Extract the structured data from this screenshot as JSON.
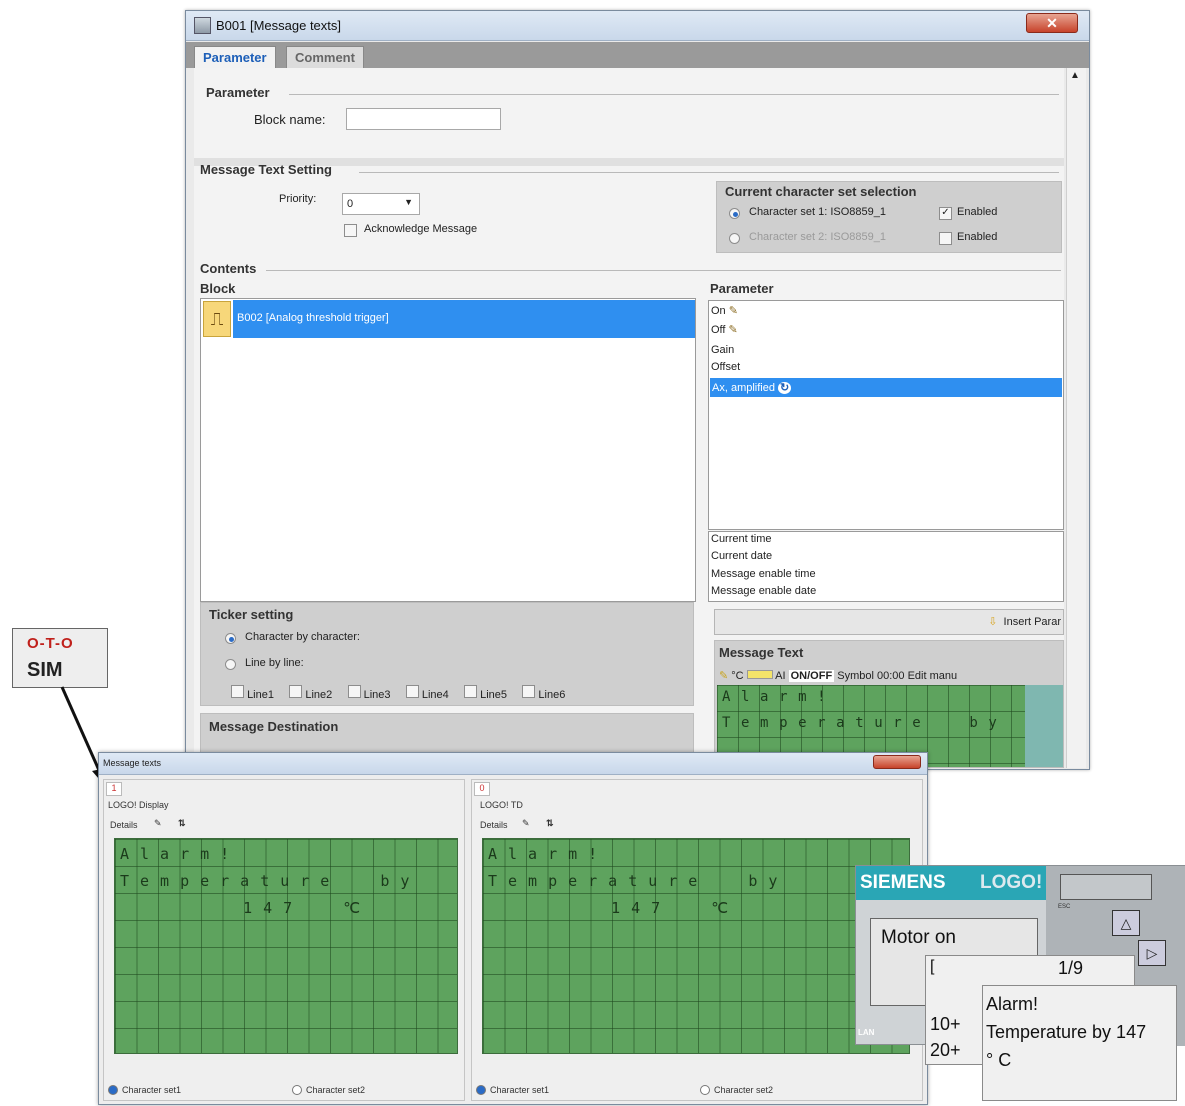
{
  "main_window": {
    "title": "B001 [Message texts]",
    "tabs": [
      "Parameter",
      "Comment"
    ],
    "parameter_section": {
      "title": "Parameter",
      "block_name_label": "Block name:",
      "block_name_value": ""
    },
    "message_text_setting": {
      "title": "Message Text Setting",
      "priority_label": "Priority:",
      "priority_value": "0",
      "acknowledge_label": "Acknowledge Message"
    },
    "charset_selection": {
      "title": "Current character set selection",
      "set1_label": "Character set 1: ISO8859_1",
      "set1_enabled": "Enabled",
      "set2_label": "Character set 2: ISO8859_1",
      "set2_enabled": "Enabled"
    },
    "contents": {
      "title": "Contents",
      "block_header": "Block",
      "block_item": "B002 [Analog threshold trigger]",
      "parameter_header": "Parameter",
      "parameter_items": [
        "On",
        "Off",
        "Gain",
        "Offset",
        "Ax, amplified"
      ],
      "special_items": [
        "Current time",
        "Current date",
        "Message enable time",
        "Message enable date"
      ],
      "insert_param_label": "Insert Parar"
    },
    "ticker": {
      "title": "Ticker setting",
      "char_by_char": "Character by character:",
      "line_by_line": "Line by line:",
      "lines": [
        "Line1",
        "Line2",
        "Line3",
        "Line4",
        "Line5",
        "Line6"
      ]
    },
    "message_destination": {
      "title": "Message Destination"
    },
    "message_text": {
      "title": "Message Text",
      "toolbar": [
        "°C",
        "AI",
        "ON/OFF",
        "Symbol",
        "00:00",
        "Edit manu"
      ],
      "lines": [
        "Alarm!",
        "Temperature  by"
      ]
    }
  },
  "sim_icon": {
    "top": "O-T-O",
    "bottom": "SIM"
  },
  "sub_window": {
    "title": "Message texts",
    "left_tab": "1",
    "right_tab": "0",
    "left_panel": {
      "title": "LOGO! Display",
      "details_label": "Details",
      "lines": [
        "Alarm!",
        "Temperature  by",
        "    147  ℃"
      ],
      "charset1": "Character set1",
      "charset2": "Character set2"
    },
    "right_panel": {
      "title": "LOGO! TD",
      "details_label": "Details",
      "lines": [
        "Alarm!",
        "Temperature  by",
        "    147  ℃"
      ],
      "charset1": "Character set1",
      "charset2": "Character set2"
    }
  },
  "logo_device": {
    "brand": "SIEMENS",
    "product": "LOGO!",
    "screen1": "Motor on",
    "screen2_page": "1/9",
    "screen2_lines": [
      "10+",
      "20+"
    ],
    "screen3_lines": [
      "Alarm!",
      "Temperature by 147",
      "° C"
    ],
    "key_labels": [
      "ESC",
      "LAN"
    ]
  },
  "colors": {
    "lcd_green": "#5ea35e",
    "selection_blue": "#2f8ff0",
    "siemens_teal": "#2aa6b5"
  }
}
